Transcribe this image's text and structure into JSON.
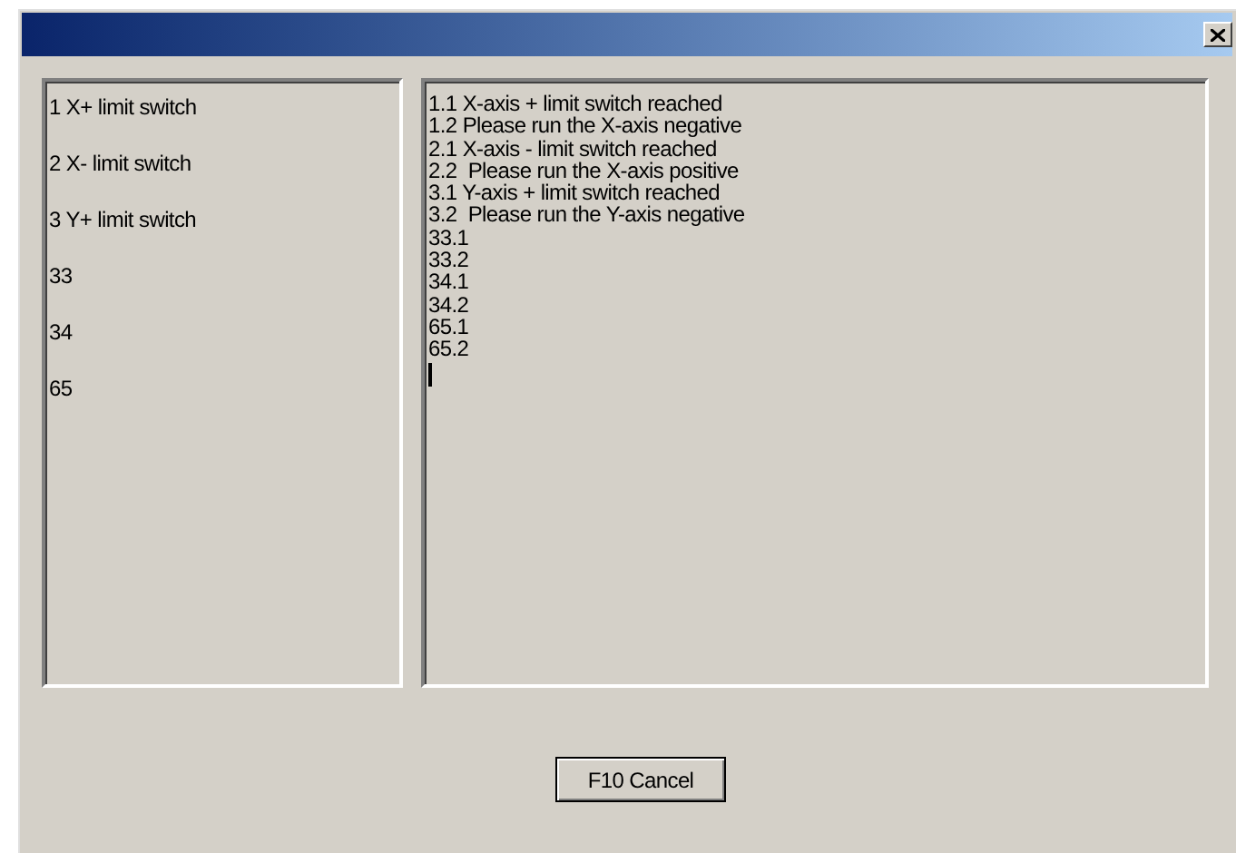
{
  "switch_list": [
    "1 X+ limit switch",
    "2 X- limit switch",
    "3 Y+ limit switch",
    "33",
    "34",
    "65"
  ],
  "message_log": [
    "1.1 X-axis + limit switch reached",
    "1.2 Please run the X-axis negative",
    "2.1 X-axis - limit switch reached",
    "2.2  Please run the X-axis positive",
    "3.1 Y-axis + limit switch reached",
    "3.2  Please run the Y-axis negative",
    "33.1",
    "33.2",
    "34.1",
    "34.2",
    "65.1",
    "65.2"
  ],
  "buttons": [
    "F10 Cancel"
  ]
}
